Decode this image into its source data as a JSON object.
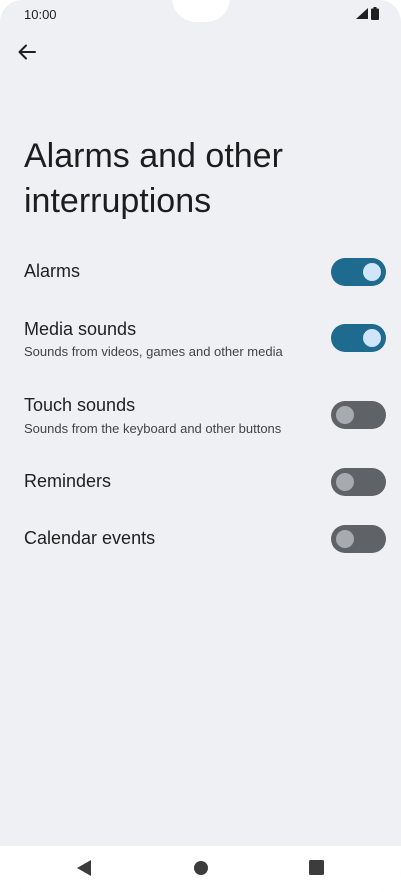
{
  "status_bar": {
    "time": "10:00",
    "icons": [
      "signal-icon",
      "battery-icon"
    ]
  },
  "header": {
    "back_icon": "arrow-left-icon",
    "title": "Alarms and other interruptions"
  },
  "settings": [
    {
      "label": "Alarms",
      "sublabel": "",
      "enabled": true
    },
    {
      "label": "Media sounds",
      "sublabel": "Sounds from videos, games and other media",
      "enabled": true
    },
    {
      "label": "Touch sounds",
      "sublabel": "Sounds from the keyboard and other buttons",
      "enabled": false
    },
    {
      "label": "Reminders",
      "sublabel": "",
      "enabled": false
    },
    {
      "label": "Calendar events",
      "sublabel": "",
      "enabled": false
    }
  ],
  "nav_bar": {
    "buttons": [
      "back-triangle-icon",
      "home-circle-icon",
      "recents-square-icon"
    ]
  },
  "colors": {
    "background": "#eff0f3",
    "toggle_on_track": "#1f6a8f",
    "toggle_on_knob": "#cfe6fa",
    "toggle_off_track": "#5f6368",
    "toggle_off_knob": "#a7aaae"
  }
}
